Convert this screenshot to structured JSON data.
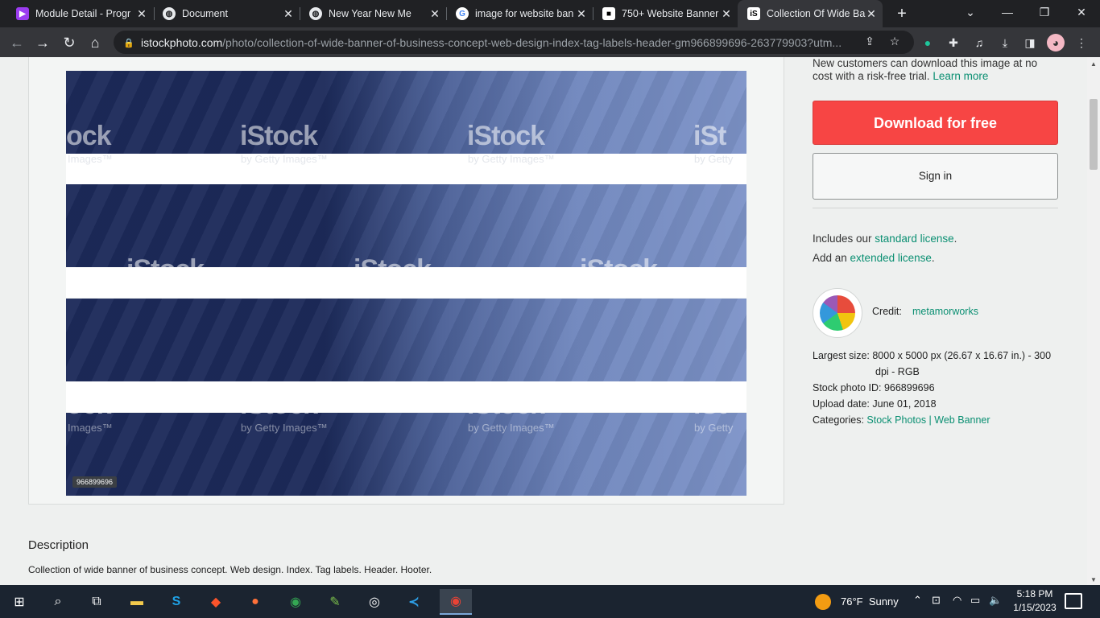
{
  "browser": {
    "tabs": [
      {
        "title": "Module Detail - Progr",
        "favicon": "purple-doc-icon",
        "color": "#9b3cf0"
      },
      {
        "title": "Document",
        "favicon": "globe-icon",
        "color": "#e8eaed"
      },
      {
        "title": "New Year New Me",
        "favicon": "globe-icon",
        "color": "#e8eaed"
      },
      {
        "title": "image for website ban",
        "favicon": "google-icon",
        "color": "#e8eaed"
      },
      {
        "title": "750+ Website Banner",
        "favicon": "unsplash-icon",
        "color": "#e8eaed"
      },
      {
        "title": "Collection Of Wide Ba",
        "favicon": "istock-icon",
        "color": "#ffffff",
        "active": true
      }
    ],
    "favicon_text": {
      "istock": "iS"
    },
    "url_host": "istockphoto.com",
    "url_path": "/photo/collection-of-wide-banner-of-business-concept-web-design-index-tag-labels-header-gm966899696-263779903?utm...",
    "window_controls": {
      "minimize": "—",
      "restore": "❐",
      "close": "✕"
    }
  },
  "image": {
    "watermark_main": "iStock",
    "watermark_sub": "by Getty Images™",
    "watermark_fragment_left": "ock",
    "watermark_fragment_sub_left": "Images™",
    "watermark_fragment_right": "iSt",
    "watermark_fragment_sub_right": "by Getty",
    "id_tag": "966899696"
  },
  "sidebar": {
    "trial_note": "New customers can download this image at no cost with a risk-free trial.",
    "trial_link": "Learn more",
    "download_label": "Download for free",
    "signin_label": "Sign in",
    "license_line1_prefix": "Includes our ",
    "license_line1_link": "standard license",
    "license_line1_suffix": ".",
    "license_line2_prefix": "Add an ",
    "license_line2_link": "extended license",
    "license_line2_suffix": ".",
    "credit_label": "Credit:",
    "credit_name": "metamorworks",
    "largest_size_label": "Largest size:",
    "largest_size_value": "8000 x 5000 px (26.67 x 16.67 in.) - 300",
    "largest_size_value2": "dpi - RGB",
    "stock_id_label": "Stock photo ID:",
    "stock_id_value": "966899696",
    "upload_label": "Upload date:",
    "upload_value": "June 01, 2018",
    "categories_label": "Categories:",
    "category_1": "Stock Photos",
    "category_sep": " | ",
    "category_2": "Web Banner"
  },
  "description": {
    "heading": "Description",
    "text": "Collection of wide banner of business concept. Web design. Index. Tag labels. Header. Hooter."
  },
  "taskbar": {
    "weather_temp": "76°F",
    "weather_cond": "Sunny",
    "time": "5:18 PM",
    "date": "1/15/2023"
  }
}
